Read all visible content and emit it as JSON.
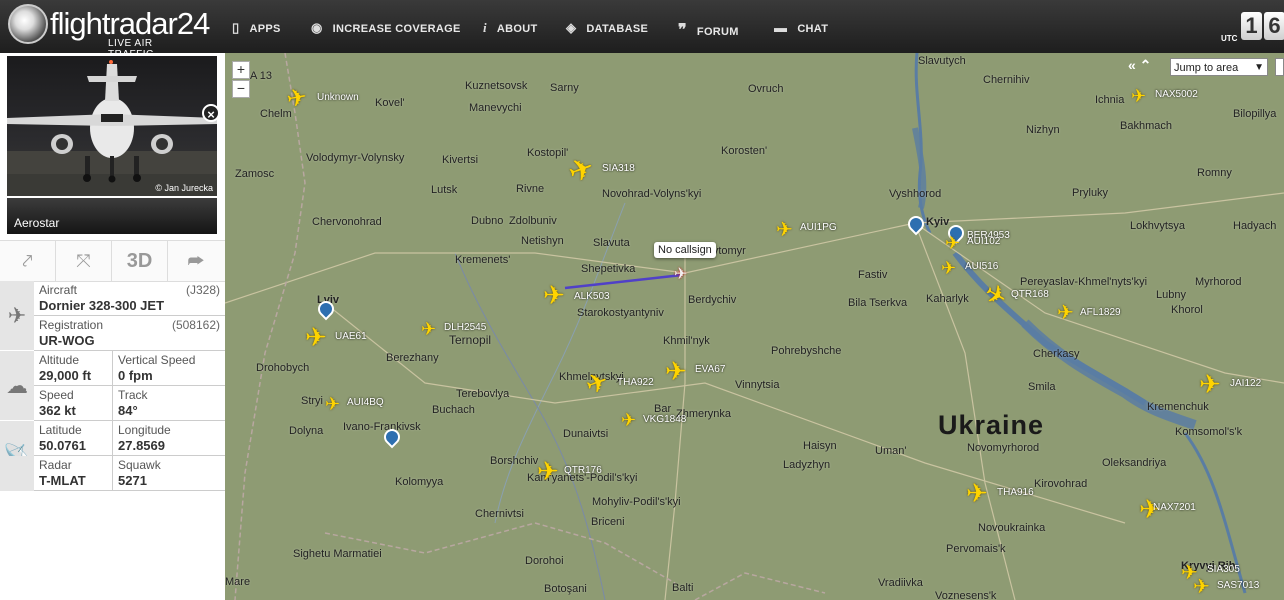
{
  "header": {
    "logo_name": "flightradar24",
    "logo_tagline": "LIVE AIR TRAFFIC",
    "nav": [
      {
        "label": "APPS",
        "icon": "phone-icon"
      },
      {
        "label": "INCREASE COVERAGE",
        "icon": "eye-icon"
      },
      {
        "label": "ABOUT",
        "icon": "info-icon"
      },
      {
        "label": "DATABASE",
        "icon": "database-icon"
      },
      {
        "label": "FORUM",
        "icon": "quote-icon"
      },
      {
        "label": "CHAT",
        "icon": "chat-icon"
      }
    ],
    "utc_label": "UTC",
    "clock_digits": [
      "1",
      "6"
    ]
  },
  "panel": {
    "photo_credit": "© Jan Jurecka",
    "airline": "Aerostar",
    "tools": {
      "route_icon": "route-icon",
      "fit_icon": "fit-view-icon",
      "three_d": "3D",
      "share_icon": "share-icon"
    },
    "aircraft": {
      "label": "Aircraft",
      "value": "Dornier 328-300 JET",
      "code": "(J328)"
    },
    "registration": {
      "label": "Registration",
      "value": "UR-WOG",
      "code": "(508162)"
    },
    "altitude": {
      "label": "Altitude",
      "value": "29,000 ft"
    },
    "vertical_speed": {
      "label": "Vertical Speed",
      "value": "0 fpm"
    },
    "speed": {
      "label": "Speed",
      "value": "362 kt"
    },
    "track": {
      "label": "Track",
      "value": "84°"
    },
    "latitude": {
      "label": "Latitude",
      "value": "50.0761"
    },
    "longitude": {
      "label": "Longitude",
      "value": "27.8569"
    },
    "radar": {
      "label": "Radar",
      "value": "T-MLAT"
    },
    "squawk": {
      "label": "Squawk",
      "value": "5271"
    }
  },
  "map": {
    "country_label": "Ukraine",
    "jump_placeholder": "Jump to area",
    "callout": "No callsign",
    "partial_label": "A 13",
    "places": [
      "Slavutych",
      "Chernihiv",
      "Kuznetsovsk",
      "Sarny",
      "Ovruch",
      "Ichnia",
      "Chelm",
      "Kovel'",
      "Manevychi",
      "Nizhyn",
      "Bakhmach",
      "Bilopillya",
      "Kostopil'",
      "Korosten'",
      "Volodymyr-Volynsky",
      "Kivertsi",
      "Romny",
      "Zamosc",
      "Lutsk",
      "Rivne",
      "Novohrad-Volyns'kyi",
      "Vyshhorod",
      "Pryluky",
      "Chervonohrad",
      "Dubno",
      "Zdolbuniv",
      "Kyiv",
      "Lokhvytsya",
      "Hadyach",
      "Netishyn",
      "Slavuta",
      "Myrhorod",
      "Kremenets'",
      "Shepetivka",
      "Zhytomyr",
      "Fastiv",
      "Pereyaslav-Khmel'nyts'kyi",
      "Lubny",
      "Lviv",
      "Starokostyantyniv",
      "Berdychiv",
      "Bila Tserkva",
      "Kaharlyk",
      "Khorol",
      "Drohobych",
      "Berezhany",
      "Ternopil",
      "Khmil'nyk",
      "Pohrebyshche",
      "Cherkasy",
      "Khmelnytskyi",
      "Vinnytsia",
      "Smila",
      "Kremenchuk",
      "Stryi",
      "Terebovlya",
      "Bar",
      "Zhmerynka",
      "Ivano-Frankivsk",
      "Buchach",
      "Haisyn",
      "Uman'",
      "Komsomol's'k",
      "Dolyna",
      "Dunaivtsi",
      "Ladyzhyn",
      "Novomyrhorod",
      "Oleksandriya",
      "Borshchiv",
      "Kam'yanets'-Podil's'kyi",
      "Kirovohrad",
      "Kolomyya",
      "Mohyliv-Podil's'kyi",
      "Novoukrainka",
      "Chernivtsi",
      "Briceni",
      "Pervomais'k",
      "Sighetu Marmatiei",
      "Dorohoi",
      "Balti",
      "Vradiivka",
      "Voznesens'k",
      "Kryvyi Rih",
      "Botoşani",
      "Mare"
    ],
    "flights": [
      "Unknown",
      "NAX5002",
      "SIA318",
      "AUI1PG",
      "BER4953",
      "AUI102",
      "AUI516",
      "QTR168",
      "AFL1829",
      "ALK503",
      "UAE61",
      "DLH2545",
      "EVA67",
      "THA922",
      "JAI122",
      "AUI4BQ",
      "VKG1848",
      "QTR176",
      "THA916",
      "NAX7201",
      "SIA305",
      "SAS7013"
    ]
  }
}
